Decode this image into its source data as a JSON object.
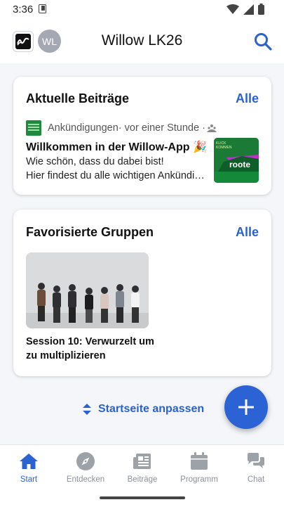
{
  "status_bar": {
    "time": "3:36"
  },
  "header": {
    "title": "Willow LK26",
    "avatar_initials": "WL"
  },
  "recent_posts": {
    "title": "Aktuelle Beiträge",
    "all_label": "Alle",
    "post": {
      "group": "Ankündigungen",
      "meta": " · vor einer Stunde · ",
      "title": "Willkommen in der Willow-App 🎉",
      "line1": "Wie schön, dass du dabei bist!",
      "line2": "Hier findest du alle wichtigen Ankündigungen",
      "thumb_text_top": "KLICK",
      "thumb_text_mid": "KOMMEN",
      "thumb_word": "roote"
    }
  },
  "favorite_groups": {
    "title": "Favorisierte Gruppen",
    "all_label": "Alle",
    "group": {
      "name": "Session 10: Verwurzelt um zu multiplizieren"
    }
  },
  "customize_label": "Startseite anpassen",
  "bottom_nav": [
    {
      "label": "Start",
      "icon": "home-icon",
      "active": true
    },
    {
      "label": "Entdecken",
      "icon": "compass-icon",
      "active": false
    },
    {
      "label": "Beiträge",
      "icon": "newspaper-icon",
      "active": false
    },
    {
      "label": "Programm",
      "icon": "calendar-icon",
      "active": false
    },
    {
      "label": "Chat",
      "icon": "chat-icon",
      "active": false
    }
  ],
  "colors": {
    "accent": "#2a62d1",
    "fab": "#2c63d4",
    "group_green": "#1f8a3c",
    "inactive": "#8c9199"
  }
}
